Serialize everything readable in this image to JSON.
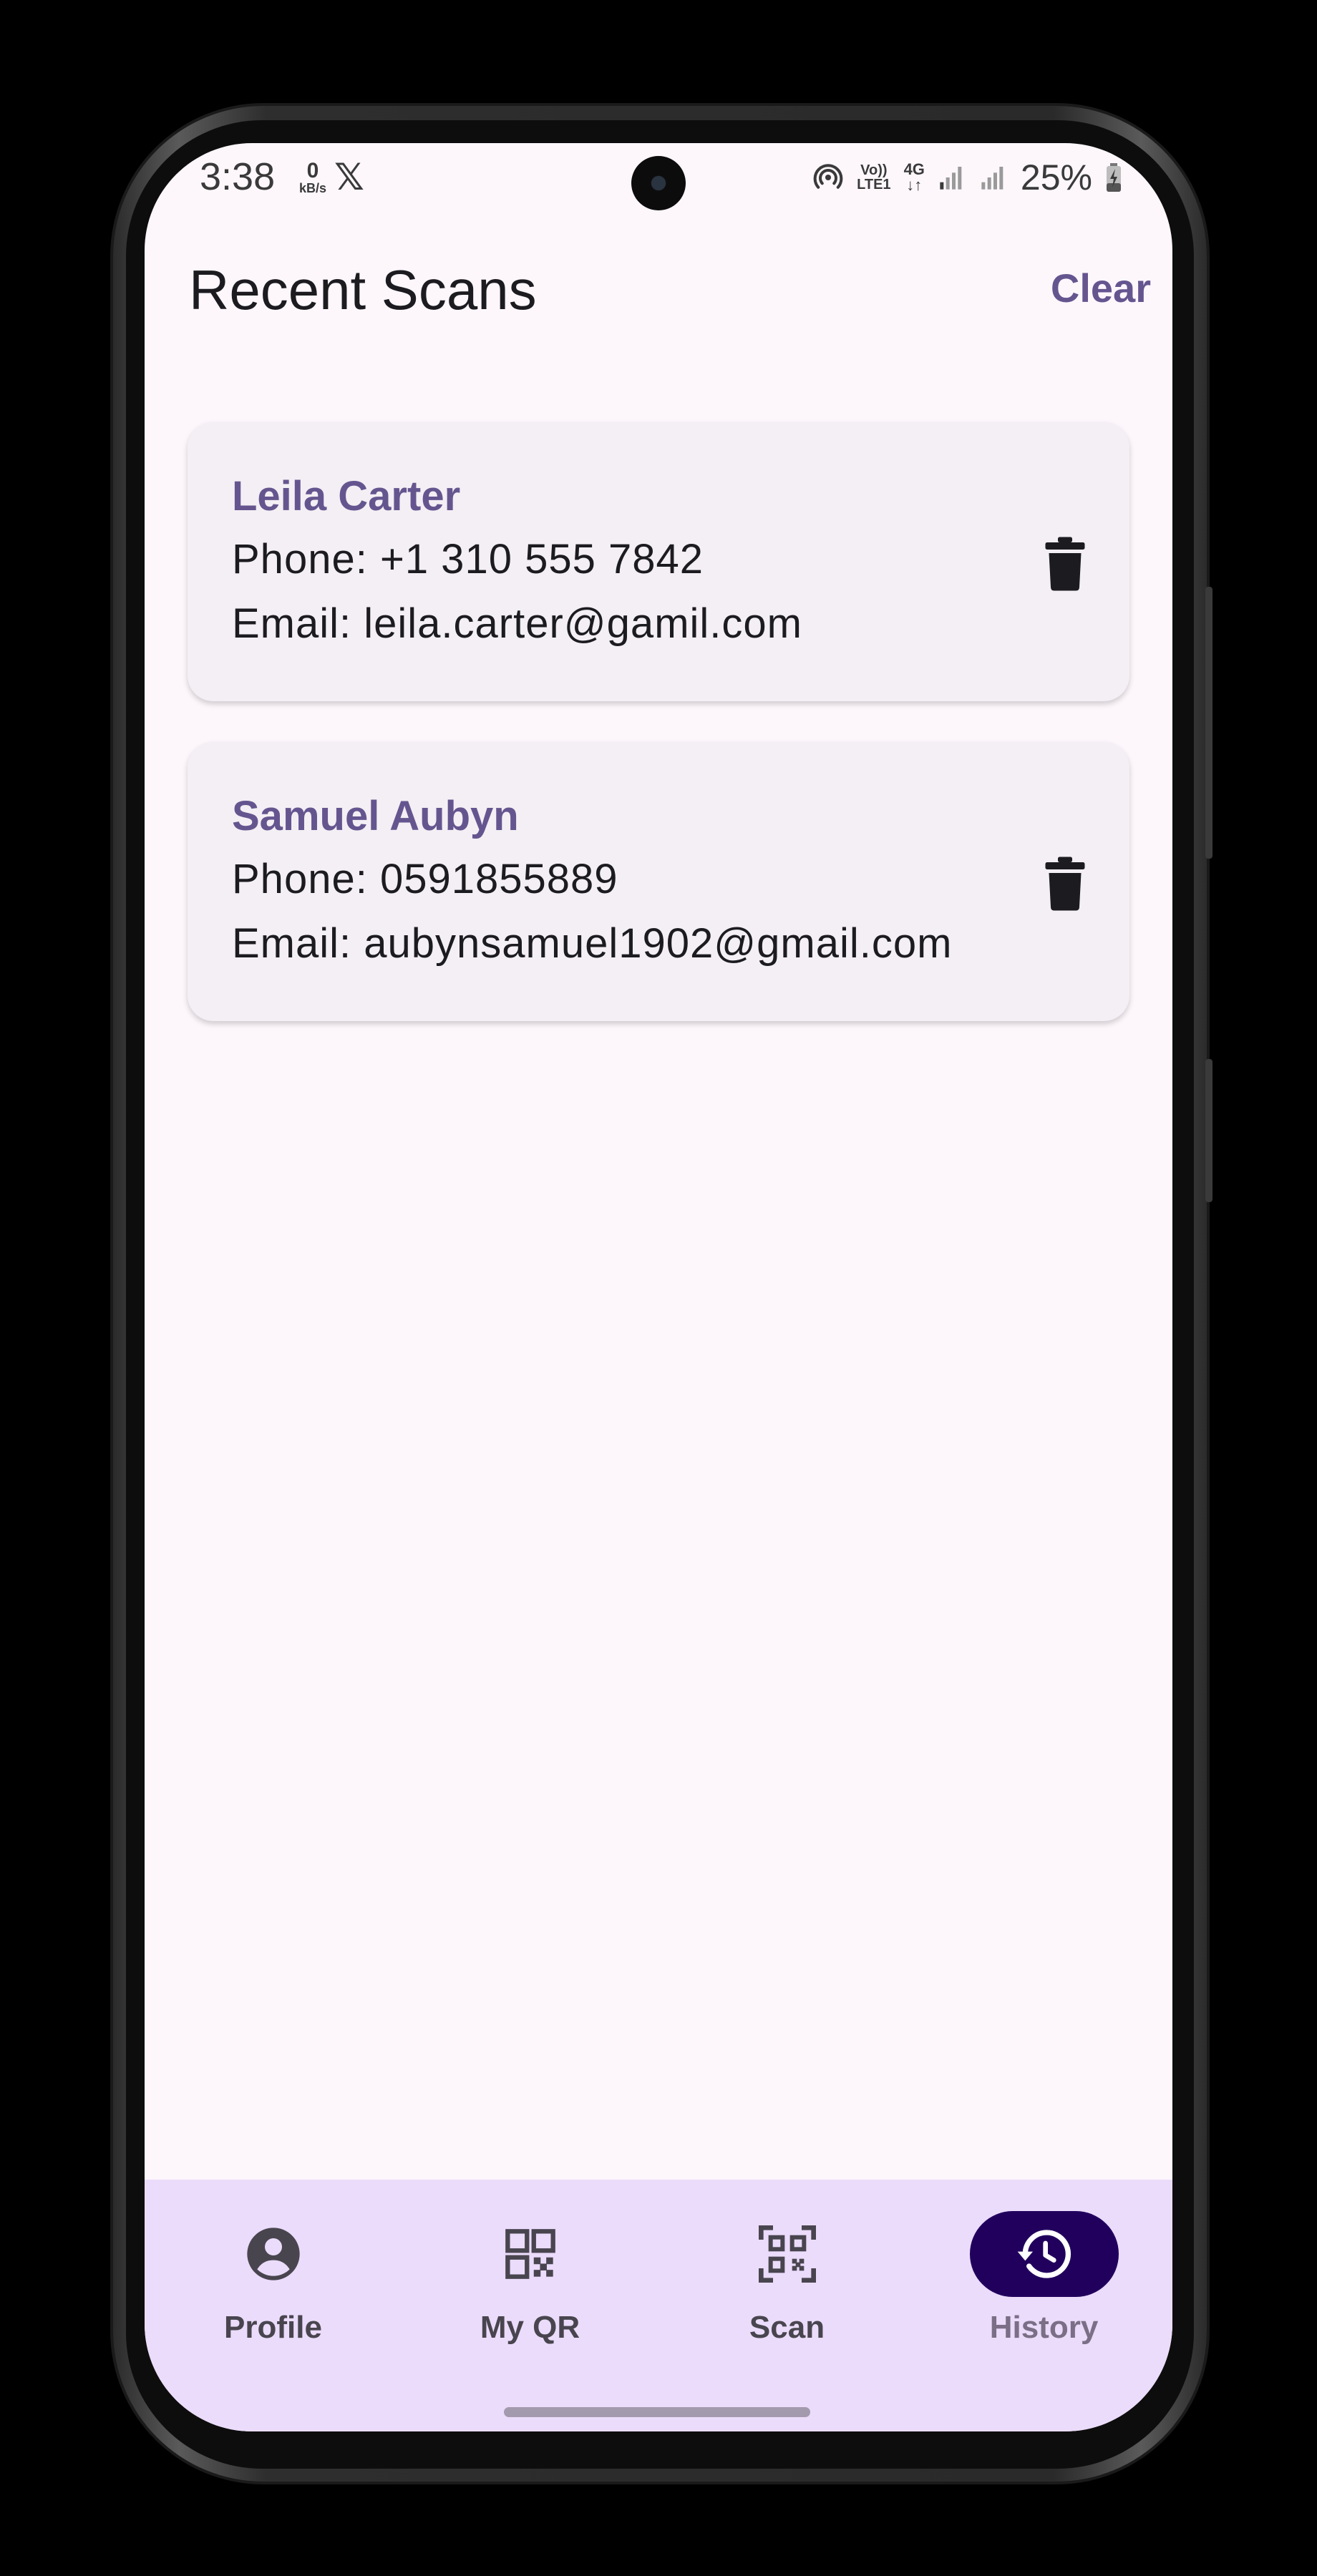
{
  "status_bar": {
    "time": "3:38",
    "net_speed_value": "0",
    "net_speed_unit": "kB/s",
    "x_app": "𝕏",
    "volte_top": "Vo))",
    "volte_bottom": "LTE1",
    "network_type": "4G",
    "battery_percent": "25%"
  },
  "app_bar": {
    "title": "Recent Scans",
    "clear_label": "Clear"
  },
  "scans": [
    {
      "name": "Leila Carter",
      "phone": "Phone: +1 310 555 7842",
      "email": "Email: leila.carter@gamil.com"
    },
    {
      "name": "Samuel Aubyn",
      "phone": "Phone: 0591855889",
      "email": "Email: aubynsamuel1902@gmail.com"
    }
  ],
  "bottom_nav": {
    "items": [
      {
        "label": "Profile",
        "icon": "account-circle-icon"
      },
      {
        "label": "My QR",
        "icon": "qr-code-icon"
      },
      {
        "label": "Scan",
        "icon": "qr-scanner-icon"
      },
      {
        "label": "History",
        "icon": "history-icon",
        "active": true
      }
    ]
  },
  "colors": {
    "accent": "#65558f",
    "nav_background": "#ebdcfb",
    "active_pill": "#21005d",
    "screen_background": "#fdf7fc",
    "card_background": "#f3eff4"
  }
}
